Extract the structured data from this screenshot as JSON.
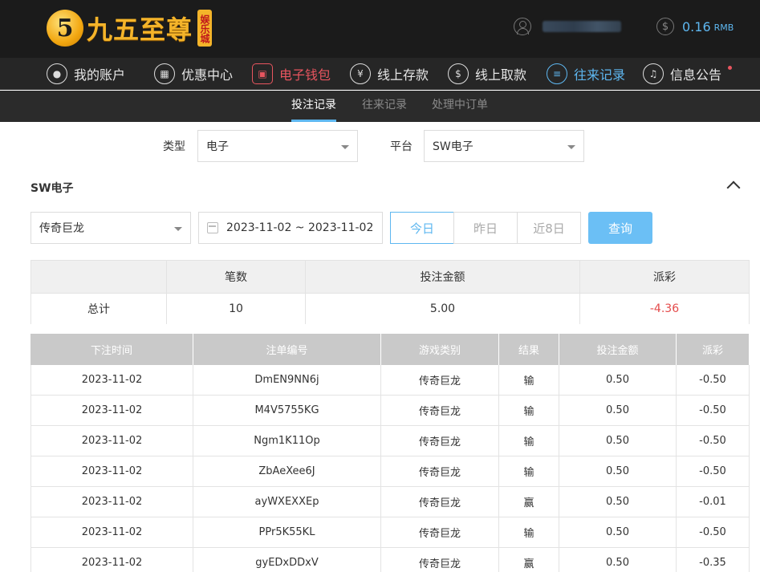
{
  "header": {
    "brand_text": "九五至尊",
    "brand_badge": "娱乐城",
    "brand_mark": "5",
    "balance_amount": "0.16",
    "balance_currency": "RMB"
  },
  "nav": {
    "items": [
      {
        "label": "我的账户",
        "icon": "user-icon"
      },
      {
        "label": "优惠中心",
        "icon": "gift-icon"
      },
      {
        "label": "电子钱包",
        "icon": "wallet-icon"
      },
      {
        "label": "线上存款",
        "icon": "deposit-icon"
      },
      {
        "label": "线上取款",
        "icon": "withdraw-icon"
      },
      {
        "label": "往来记录",
        "icon": "records-icon"
      },
      {
        "label": "信息公告",
        "icon": "bell-icon"
      }
    ]
  },
  "subnav": {
    "items": [
      "投注记录",
      "往来记录",
      "处理中订单"
    ]
  },
  "filters": {
    "type_label": "类型",
    "type_value": "电子",
    "platform_label": "平台",
    "platform_value": "SW电子"
  },
  "section": {
    "title": "SW电子",
    "game_value": "传奇巨龙",
    "date_range": "2023-11-02 ~ 2023-11-02",
    "quick_today": "今日",
    "quick_yesterday": "昨日",
    "quick_8days": "近8日",
    "query_label": "查询"
  },
  "summary": {
    "headers": [
      "",
      "笔数",
      "投注金额",
      "派彩"
    ],
    "row_label": "总计",
    "count": "10",
    "bet_total": "5.00",
    "payout_total": "-4.36"
  },
  "table": {
    "headers": [
      "下注时间",
      "注单编号",
      "游戏类别",
      "结果",
      "投注金额",
      "派彩"
    ],
    "rows": [
      [
        "2023-11-02",
        "DmEN9NN6j",
        "传奇巨龙",
        "输",
        "0.50",
        "-0.50"
      ],
      [
        "2023-11-02",
        "M4V5755KG",
        "传奇巨龙",
        "输",
        "0.50",
        "-0.50"
      ],
      [
        "2023-11-02",
        "Ngm1K11Op",
        "传奇巨龙",
        "输",
        "0.50",
        "-0.50"
      ],
      [
        "2023-11-02",
        "ZbAeXee6J",
        "传奇巨龙",
        "输",
        "0.50",
        "-0.50"
      ],
      [
        "2023-11-02",
        "ayWXEXXEp",
        "传奇巨龙",
        "赢",
        "0.50",
        "-0.01"
      ],
      [
        "2023-11-02",
        "PPr5K55KL",
        "传奇巨龙",
        "输",
        "0.50",
        "-0.50"
      ],
      [
        "2023-11-02",
        "gyEDxDDxV",
        "传奇巨龙",
        "赢",
        "0.50",
        "-0.35"
      ]
    ]
  },
  "colors": {
    "accent": "#5eb7f0",
    "negative": "#e44b4b",
    "brand_gold": "#f4b42a"
  }
}
